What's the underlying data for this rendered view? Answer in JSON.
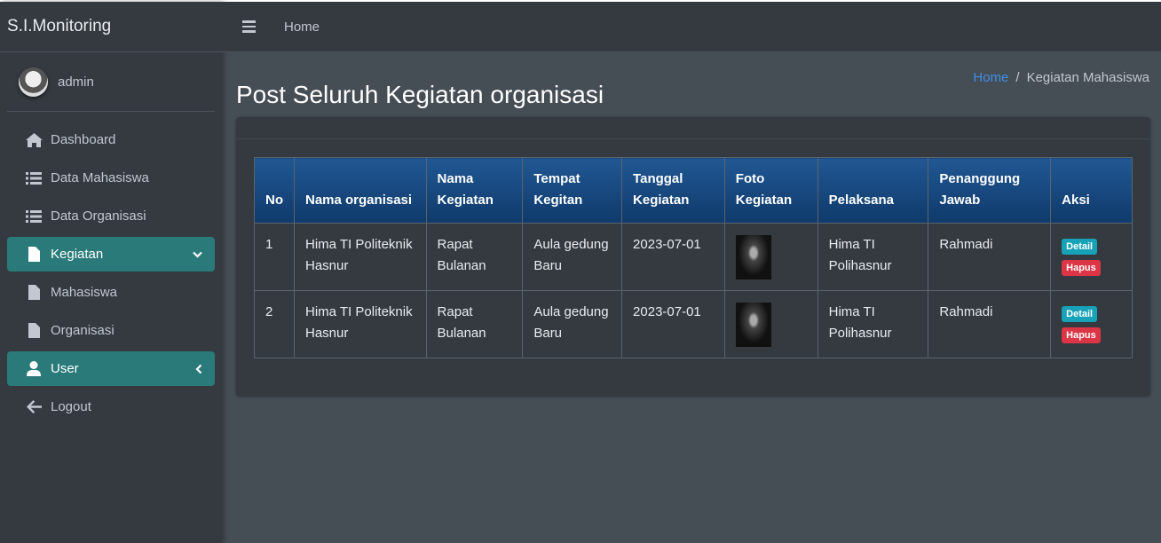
{
  "brand": "S.I.Monitoring",
  "user": {
    "name": "admin"
  },
  "sidebar": {
    "items": [
      {
        "label": "Dashboard",
        "icon": "home-icon"
      },
      {
        "label": "Data Mahasiswa",
        "icon": "list-icon"
      },
      {
        "label": "Data Organisasi",
        "icon": "list-icon"
      },
      {
        "label": "Kegiatan",
        "icon": "file-icon",
        "active": true,
        "arrow": "chevron-down-icon"
      },
      {
        "label": "Mahasiswa",
        "icon": "file-icon"
      },
      {
        "label": "Organisasi",
        "icon": "file-icon"
      },
      {
        "label": "User",
        "icon": "user-icon",
        "active": true,
        "arrow": "chevron-left-icon"
      },
      {
        "label": "Logout",
        "icon": "arrow-left-icon"
      }
    ]
  },
  "navbar": {
    "home": "Home"
  },
  "page": {
    "title": "Post Seluruh Kegiatan organisasi",
    "breadcrumb": {
      "home": "Home",
      "separator": "/",
      "current": "Kegiatan Mahasiswa"
    }
  },
  "table": {
    "headers": [
      "No",
      "Nama organisasi",
      "Nama Kegiatan",
      "Tempat Kegitan",
      "Tanggal Kegiatan",
      "Foto Kegiatan",
      "Pelaksana",
      "Penanggung Jawab",
      "Aksi"
    ],
    "rows": [
      {
        "no": "1",
        "organisasi": "Hima TI Politeknik Hasnur",
        "kegiatan": "Rapat Bulanan",
        "tempat": "Aula gedung Baru",
        "tanggal": "2023-07-01",
        "pelaksana": "Hima TI Polihasnur",
        "pj": "Rahmadi"
      },
      {
        "no": "2",
        "organisasi": "Hima TI Politeknik Hasnur",
        "kegiatan": "Rapat Bulanan",
        "tempat": "Aula gedung Baru",
        "tanggal": "2023-07-01",
        "pelaksana": "Hima TI Polihasnur",
        "pj": "Rahmadi"
      }
    ],
    "actions": {
      "detail": "Detail",
      "delete": "Hapus"
    }
  },
  "colors": {
    "sidebar_bg": "#343a40",
    "content_bg": "#454d55",
    "active_nav": "#2a7a7a",
    "header_blue": "#1b4c84",
    "badge_info": "#17a2b8",
    "badge_danger": "#dc3545",
    "link": "#3f8fe6"
  }
}
